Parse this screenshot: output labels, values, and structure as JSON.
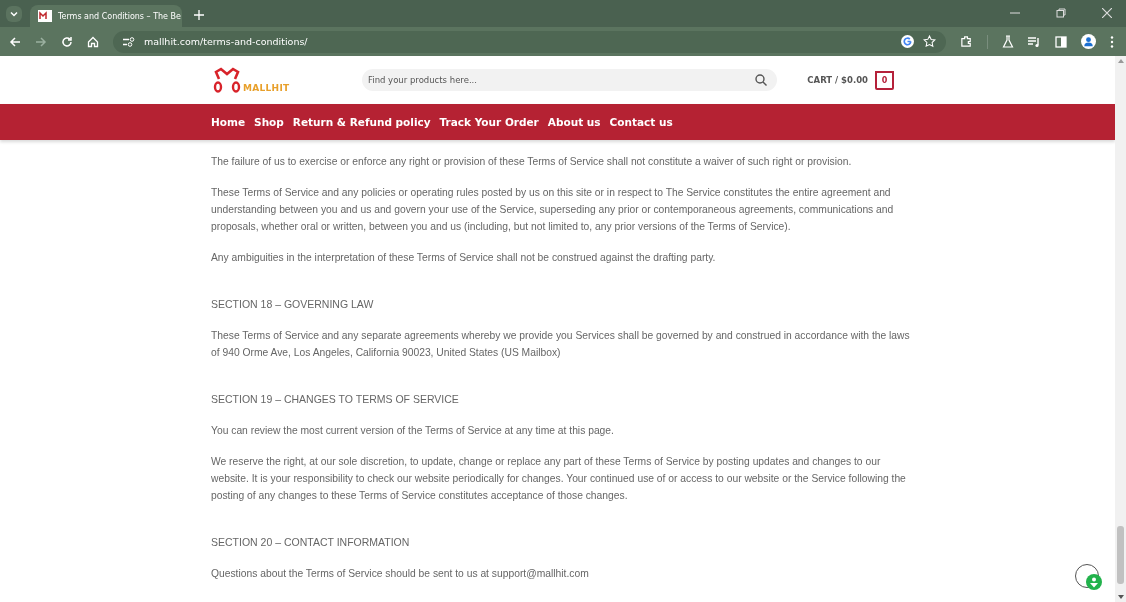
{
  "browser": {
    "tab": {
      "title": "Terms and Conditions – The Be",
      "selected": true
    },
    "address": "mallhit.com/terms-and-conditions/"
  },
  "header": {
    "logo": "MALLHIT",
    "search": {
      "placeholder": "Find your products here..."
    },
    "cart": {
      "label": "CART / $0.00",
      "count": "0"
    }
  },
  "nav": [
    {
      "label": "Home"
    },
    {
      "label": "Shop"
    },
    {
      "label": "Return & Refund policy"
    },
    {
      "label": "Track Your Order"
    },
    {
      "label": "About us"
    },
    {
      "label": "Contact us"
    }
  ],
  "content": [
    {
      "kind": "paragraph",
      "text": "The failure of us to exercise or enforce any right or provision of these Terms of Service shall not constitute a waiver of such right or provision."
    },
    {
      "kind": "paragraph",
      "text": "These Terms of Service and any policies or operating rules posted by us on this site or in respect to The Service constitutes the entire agreement and understanding between you and us and govern your use of the Service, superseding any prior or contemporaneous agreements, communications and proposals, whether oral or written, between you and us (including, but not limited to, any prior versions of the Terms of Service)."
    },
    {
      "kind": "paragraph",
      "text": "Any ambiguities in the interpretation of these Terms of Service shall not be construed against the drafting party."
    },
    {
      "kind": "heading",
      "text": "SECTION 18 – GOVERNING LAW"
    },
    {
      "kind": "paragraph",
      "text": "These Terms of Service and any separate agreements whereby we provide you Services shall be governed by and construed in accordance with the laws of 940 Orme Ave, Los Angeles, California 90023, United States (US Mailbox)"
    },
    {
      "kind": "heading",
      "text": "SECTION 19 – CHANGES TO TERMS OF SERVICE"
    },
    {
      "kind": "paragraph",
      "text": "You can review the most current version of the Terms of Service at any time at this page."
    },
    {
      "kind": "paragraph",
      "text": "We reserve the right, at our sole discretion, to update, change or replace any part of these Terms of Service by posting updates and changes to our website. It is your responsibility to check our website periodically for changes. Your continued use of or access to our website or the Service following the posting of any changes to these Terms of Service constitutes acceptance of those changes."
    },
    {
      "kind": "heading",
      "text": "SECTION 20 – CONTACT INFORMATION"
    },
    {
      "kind": "paragraph",
      "text": "Questions about the Terms of Service should be sent to us at support@mallhit.com"
    }
  ]
}
